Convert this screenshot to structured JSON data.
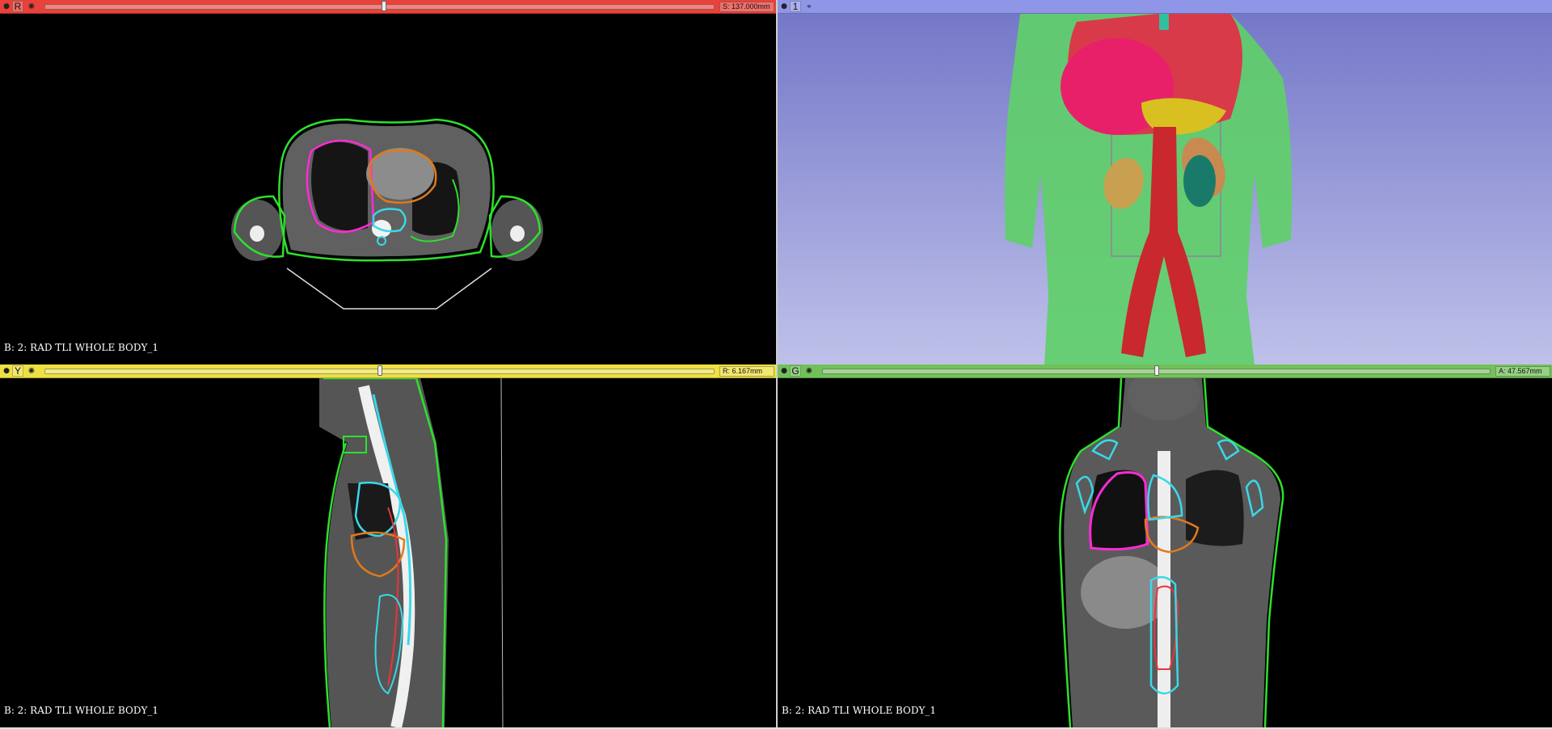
{
  "views": {
    "red": {
      "letter": "R",
      "offset": "S: 137.000mm",
      "slider_fraction": 0.507,
      "volume_label": "B: 2: RAD TLI WHOLE BODY_1",
      "color": "#e8423a"
    },
    "threed": {
      "letter": "1",
      "color": "#8f96e8"
    },
    "yellow": {
      "letter": "Y",
      "offset": "R: 6.167mm",
      "slider_fraction": 0.501,
      "volume_label": "B: 2: RAD TLI WHOLE BODY_1",
      "color": "#ede042"
    },
    "green": {
      "letter": "G",
      "offset": "A: 47.567mm",
      "slider_fraction": 0.5,
      "volume_label": "B: 2: RAD TLI WHOLE BODY_1",
      "color": "#72c05a"
    }
  },
  "icons": {
    "pin": "pin-icon",
    "options": "slice-options-icon",
    "center": "center-view-icon"
  },
  "segment_colors": {
    "body": "#2ee02e",
    "right_lung": "#ff2bd6",
    "heart": "#e07a1a",
    "spine": "#3ad8e8",
    "aorta": "#e8353a"
  }
}
